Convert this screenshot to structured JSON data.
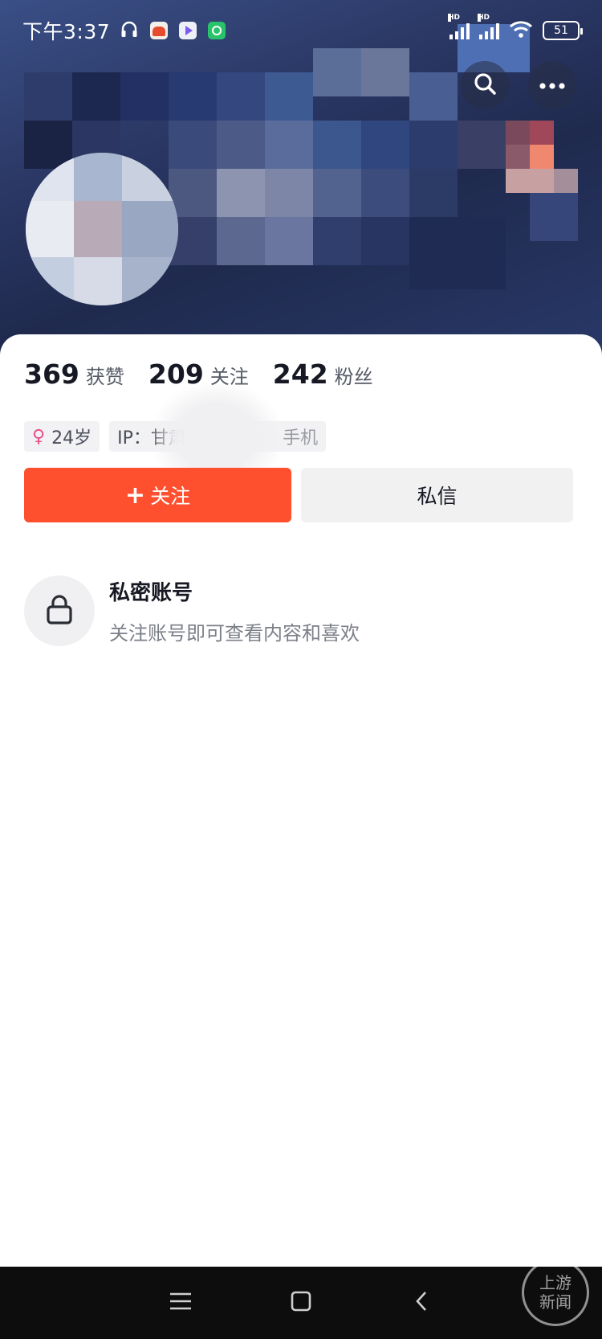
{
  "status_bar": {
    "time": "下午3:37",
    "battery": "51",
    "hd_label": "HD"
  },
  "profile": {
    "stats": [
      {
        "value": "369",
        "label": "获赞"
      },
      {
        "value": "209",
        "label": "关注"
      },
      {
        "value": "242",
        "label": "粉丝"
      }
    ],
    "tags": {
      "age": "24岁",
      "ip": "IP：甘肃",
      "ip_suffix": "手机"
    },
    "follow_label": "关注",
    "message_label": "私信"
  },
  "private_account": {
    "title": "私密账号",
    "subtitle": "关注账号即可查看内容和喜欢"
  },
  "watermark": {
    "line1": "上游",
    "line2": "新闻"
  },
  "colors": {
    "accent": "#fe4f2e",
    "gender_icon": "#ea4c89"
  }
}
